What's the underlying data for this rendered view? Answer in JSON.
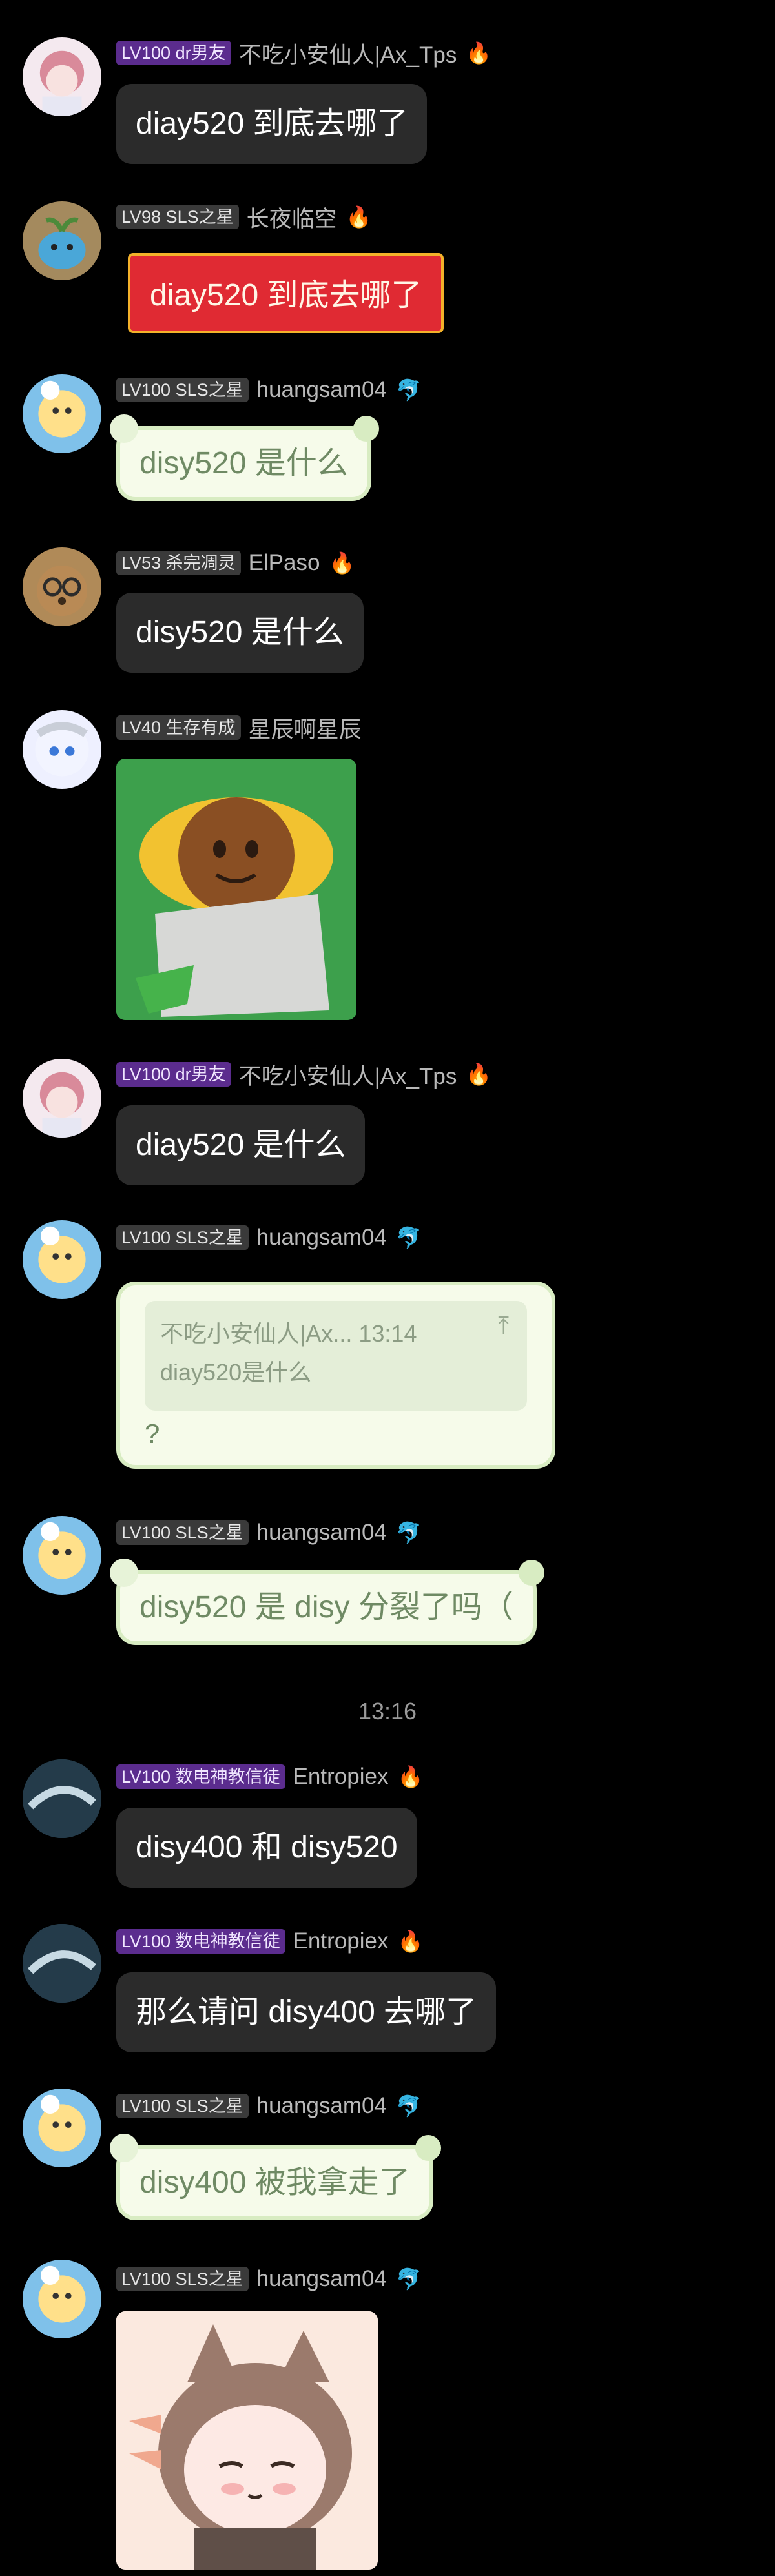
{
  "messages": [
    {
      "badge": "LV100 dr男友",
      "name": "不吃小安仙人|Ax_Tps",
      "flair": "🔥",
      "text": "diay520 到底去哪了"
    },
    {
      "badge": "LV98 SLS之星",
      "name": "长夜临空",
      "flair": "🔥",
      "text": "diay520 到底去哪了"
    },
    {
      "badge": "LV100 SLS之星",
      "name": "huangsam04",
      "flair": "🐬",
      "text": "disy520 是什么"
    },
    {
      "badge": "LV53 杀完凋灵",
      "name": "ElPaso",
      "flair": "🔥",
      "text": "disy520 是什么"
    },
    {
      "badge": "LV40 生存有成",
      "name": "星辰啊星辰",
      "flair": ""
    },
    {
      "badge": "LV100 dr男友",
      "name": "不吃小安仙人|Ax_Tps",
      "flair": "🔥",
      "text": "diay520 是什么"
    },
    {
      "badge": "LV100 SLS之星",
      "name": "huangsam04",
      "flair": "🐬",
      "quote_head": "不吃小安仙人|Ax...  13:14",
      "quote_body": "diay520是什么",
      "quote_icon": "⤒",
      "text": "?"
    },
    {
      "badge": "LV100 SLS之星",
      "name": "huangsam04",
      "flair": "🐬",
      "text": "disy520 是 disy 分裂了吗（"
    },
    {
      "badge": "LV100 数电神教信徒",
      "name": "Entropiex",
      "flair": "🔥",
      "text": "disy400 和 disy520"
    },
    {
      "badge": "LV100 数电神教信徒",
      "name": "Entropiex",
      "flair": "🔥",
      "text": "那么请问 disy400 去哪了"
    },
    {
      "badge": "LV100 SLS之星",
      "name": "huangsam04",
      "flair": "🐬",
      "text": "disy400 被我拿走了"
    },
    {
      "badge": "LV100 SLS之星",
      "name": "huangsam04",
      "flair": "🐬"
    }
  ],
  "timestamp": "13:16",
  "colors": {
    "background": "#000000",
    "bubble": "#2b2b2b",
    "badge_purple": "#5b2c8e",
    "red_bubble": "#e02a33",
    "green_bubble": "#f6fbea"
  }
}
